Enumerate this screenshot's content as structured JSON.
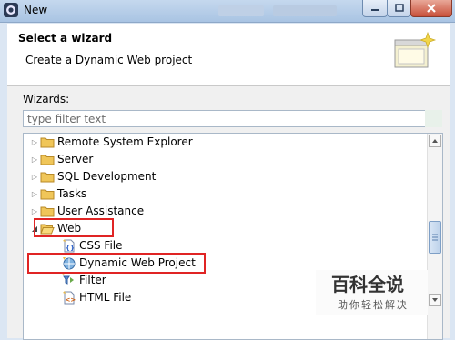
{
  "window": {
    "title": "New",
    "app_icon": "eclipse-icon",
    "controls": [
      "minimize-icon",
      "maximize-icon",
      "close-icon"
    ]
  },
  "header": {
    "title": "Select a wizard",
    "description": "Create a Dynamic Web project",
    "icon": "wizard-banner-icon"
  },
  "wizards": {
    "label": "Wizards:",
    "filter_placeholder": "type filter text",
    "tree": [
      {
        "label": "Remote System Explorer",
        "expanded": false,
        "icon": "folder-icon"
      },
      {
        "label": "Server",
        "expanded": false,
        "icon": "folder-icon"
      },
      {
        "label": "SQL Development",
        "expanded": false,
        "icon": "folder-icon"
      },
      {
        "label": "Tasks",
        "expanded": false,
        "icon": "folder-icon"
      },
      {
        "label": "User Assistance",
        "expanded": false,
        "icon": "folder-icon"
      },
      {
        "label": "Web",
        "expanded": true,
        "icon": "folder-icon",
        "highlighted": true
      },
      {
        "label": "CSS File",
        "icon": "css-file-icon"
      },
      {
        "label": "Dynamic Web Project",
        "icon": "dynamic-web-project-icon",
        "highlighted": true
      },
      {
        "label": "Filter",
        "icon": "filter-icon"
      },
      {
        "label": "HTML File",
        "icon": "html-file-icon"
      }
    ],
    "scrollbar_position_fraction": 0.45
  },
  "watermark": {
    "title": "百科全说",
    "subtitle": "助你轻松解决"
  },
  "colors": {
    "highlight": "#e02424",
    "folder": "#e8b84a",
    "titlebar": "#b9cfe8"
  }
}
